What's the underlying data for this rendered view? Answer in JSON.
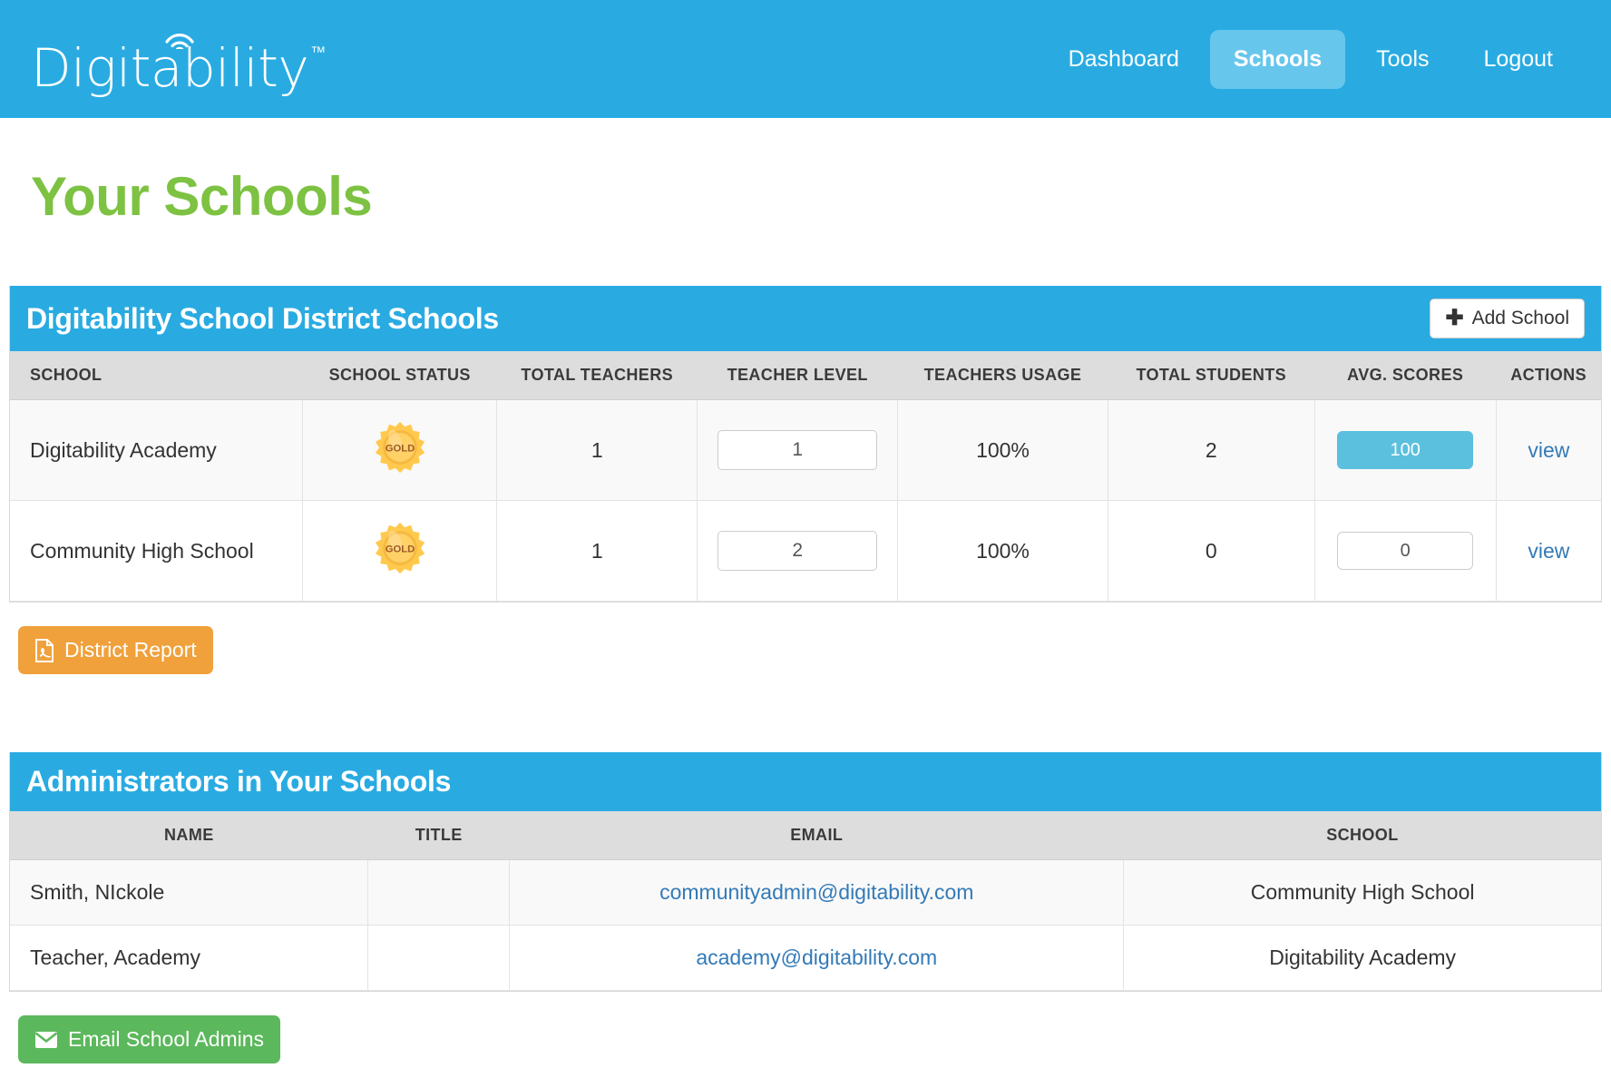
{
  "brand": {
    "name": "Digitability",
    "trademark": "™",
    "wifi_icon": "wifi-arc-icon"
  },
  "nav": {
    "items": [
      {
        "label": "Dashboard",
        "active": false
      },
      {
        "label": "Schools",
        "active": true
      },
      {
        "label": "Tools",
        "active": false
      },
      {
        "label": "Logout",
        "active": false
      }
    ]
  },
  "page": {
    "title": "Your Schools",
    "title_color": "#7dc242"
  },
  "schools_panel": {
    "title": "Digitability School District Schools",
    "header_color": "#29abe2",
    "add_button": {
      "label": "Add School",
      "icon": "plus-icon"
    },
    "columns": [
      "SCHOOL",
      "SCHOOL STATUS",
      "TOTAL TEACHERS",
      "TEACHER LEVEL",
      "TEACHERS USAGE",
      "TOTAL STUDENTS",
      "AVG. SCORES",
      "ACTIONS"
    ],
    "rows": [
      {
        "school": "Digitability Academy",
        "status_badge": "GOLD",
        "total_teachers": "1",
        "teacher_level": "1",
        "teachers_usage": "100%",
        "total_students": "2",
        "avg_score": "100",
        "avg_score_filled": true,
        "action": "view"
      },
      {
        "school": "Community High School",
        "status_badge": "GOLD",
        "total_teachers": "1",
        "teacher_level": "2",
        "teachers_usage": "100%",
        "total_students": "0",
        "avg_score": "0",
        "avg_score_filled": false,
        "action": "view"
      }
    ],
    "report_button": {
      "label": "District Report",
      "icon": "pdf-file-icon",
      "color": "#f0a13c"
    }
  },
  "admins_panel": {
    "title": "Administrators in Your Schools",
    "header_color": "#29abe2",
    "columns": [
      "NAME",
      "TITLE",
      "EMAIL",
      "SCHOOL"
    ],
    "rows": [
      {
        "name": "Smith, NIckole",
        "title": "",
        "email": "communityadmin@digitability.com",
        "school": "Community High School"
      },
      {
        "name": "Teacher, Academy",
        "title": "",
        "email": "academy@digitability.com",
        "school": "Digitability Academy"
      }
    ],
    "email_button": {
      "label": "Email School Admins",
      "icon": "envelope-icon",
      "color": "#5cb85c"
    }
  }
}
